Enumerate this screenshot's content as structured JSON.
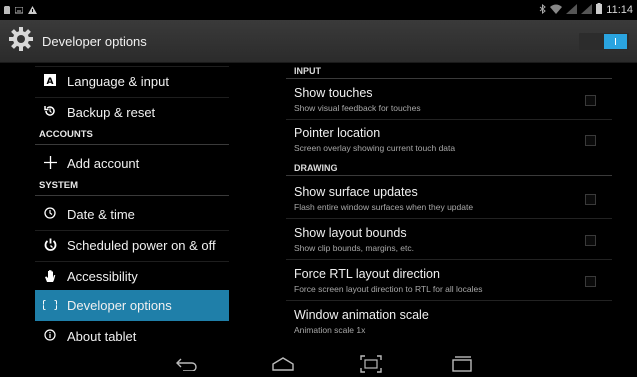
{
  "status_bar": {
    "time": "11:14",
    "icons_left": [
      "sd-card-icon",
      "keyboard-icon",
      "warning-icon"
    ],
    "icons_right": [
      "bluetooth-icon",
      "wifi-icon",
      "signal-icon",
      "signal-icon",
      "battery-icon"
    ]
  },
  "action_bar": {
    "title": "Developer options",
    "icon": "settings-gear-icon",
    "toggle_state": "on"
  },
  "left_pane": {
    "items": [
      {
        "type": "item",
        "icon": "language-icon",
        "label": "Language & input"
      },
      {
        "type": "item",
        "icon": "backup-icon",
        "label": "Backup & reset"
      },
      {
        "type": "header",
        "label": "ACCOUNTS"
      },
      {
        "type": "item",
        "icon": "add-icon",
        "label": "Add account"
      },
      {
        "type": "header",
        "label": "SYSTEM"
      },
      {
        "type": "item",
        "icon": "clock-icon",
        "label": "Date & time"
      },
      {
        "type": "item",
        "icon": "power-schedule-icon",
        "label": "Scheduled power on & off"
      },
      {
        "type": "item",
        "icon": "hand-icon",
        "label": "Accessibility"
      },
      {
        "type": "item",
        "icon": "braces-icon",
        "label": "Developer options",
        "selected": true
      },
      {
        "type": "item",
        "icon": "info-icon",
        "label": "About tablet"
      }
    ]
  },
  "right_pane": {
    "sections": [
      {
        "header": "INPUT",
        "items": [
          {
            "title": "Show touches",
            "summary": "Show visual feedback for touches",
            "checkbox": true,
            "checked": false
          },
          {
            "title": "Pointer location",
            "summary": "Screen overlay showing current touch data",
            "checkbox": true,
            "checked": false
          }
        ]
      },
      {
        "header": "DRAWING",
        "items": [
          {
            "title": "Show surface updates",
            "summary": "Flash entire window surfaces when they update",
            "checkbox": true,
            "checked": false
          },
          {
            "title": "Show layout bounds",
            "summary": "Show clip bounds, margins, etc.",
            "checkbox": true,
            "checked": false
          },
          {
            "title": "Force RTL layout direction",
            "summary": "Force screen layout direction to RTL for all locales",
            "checkbox": true,
            "checked": false
          },
          {
            "title": "Window animation scale",
            "summary": "Animation scale 1x",
            "checkbox": false
          }
        ]
      }
    ]
  },
  "nav_bar": {
    "buttons": [
      "back-icon",
      "home-icon",
      "screenshot-icon",
      "recent-apps-icon"
    ]
  }
}
